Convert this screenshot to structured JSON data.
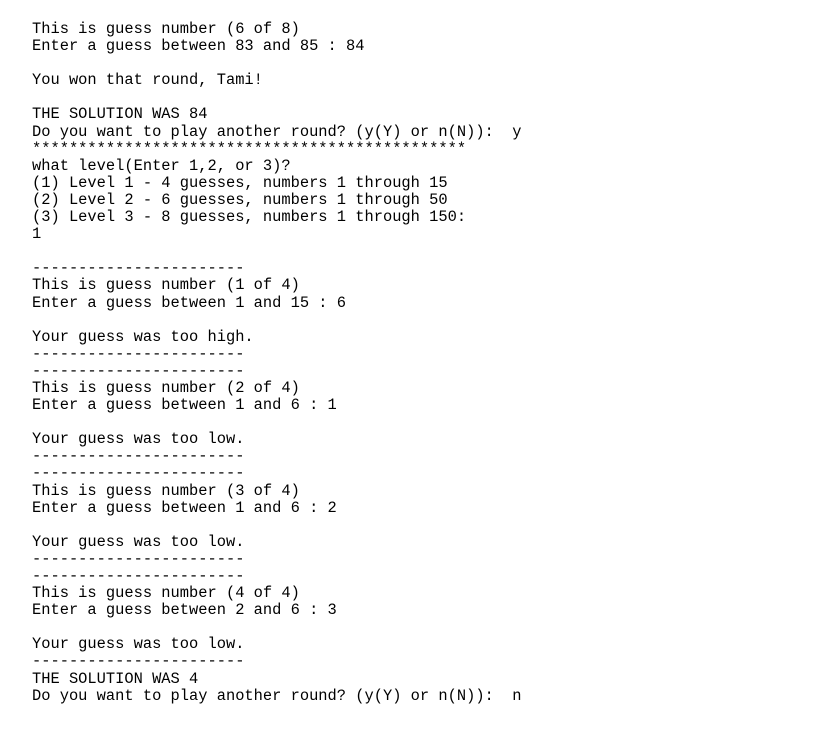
{
  "terminal": {
    "background_color": "#ffffff",
    "text_color": "#000000",
    "separator_dashes": "-----------------------",
    "separator_stars": "***********************************************",
    "lines": [
      "This is guess number (6 of 8)",
      "Enter a guess between 83 and 85 : 84",
      "",
      "You won that round, Tami!",
      "",
      "THE SOLUTION WAS 84",
      "Do you want to play another round? (y(Y) or n(N)):  y",
      "***********************************************",
      "what level(Enter 1,2, or 3)?",
      "(1) Level 1 - 4 guesses, numbers 1 through 15",
      "(2) Level 2 - 6 guesses, numbers 1 through 50",
      "(3) Level 3 - 8 guesses, numbers 1 through 150:",
      "1",
      "",
      "-----------------------",
      "This is guess number (1 of 4)",
      "Enter a guess between 1 and 15 : 6",
      "",
      "Your guess was too high.",
      "-----------------------",
      "-----------------------",
      "This is guess number (2 of 4)",
      "Enter a guess between 1 and 6 : 1",
      "",
      "Your guess was too low.",
      "-----------------------",
      "-----------------------",
      "This is guess number (3 of 4)",
      "Enter a guess between 1 and 6 : 2",
      "",
      "Your guess was too low.",
      "-----------------------",
      "-----------------------",
      "This is guess number (4 of 4)",
      "Enter a guess between 2 and 6 : 3",
      "",
      "Your guess was too low.",
      "-----------------------",
      "THE SOLUTION WAS 4",
      "Do you want to play another round? (y(Y) or n(N)):  n"
    ]
  },
  "session": {
    "player_name": "Tami",
    "round_one": {
      "guess_number_label": "This is guess number (6 of 8)",
      "prompt": "Enter a guess between 83 and 85 : 84",
      "range_low": 83,
      "range_high": 85,
      "guess_entered": 84,
      "result": "You won that round, Tami!",
      "solution_text": "THE SOLUTION WAS 84",
      "solution": 84,
      "guess_index": 6,
      "guess_total": 8,
      "play_again_prompt": "Do you want to play another round? (y(Y) or n(N)):  y",
      "play_again_answer": "y"
    },
    "level_menu": {
      "question": "what level(Enter 1,2, or 3)?",
      "options": [
        "(1) Level 1 - 4 guesses, numbers 1 through 15",
        "(2) Level 2 - 6 guesses, numbers 1 through 50",
        "(3) Level 3 - 8 guesses, numbers 1 through 150:"
      ],
      "selected": "1"
    },
    "round_two": {
      "guesses": [
        {
          "header": "This is guess number (1 of 4)",
          "prompt": "Enter a guess between 1 and 15 : 6",
          "feedback": "Your guess was too high.",
          "index": 1,
          "total": 4,
          "range_low": 1,
          "range_high": 15,
          "value": 6
        },
        {
          "header": "This is guess number (2 of 4)",
          "prompt": "Enter a guess between 1 and 6 : 1",
          "feedback": "Your guess was too low.",
          "index": 2,
          "total": 4,
          "range_low": 1,
          "range_high": 6,
          "value": 1
        },
        {
          "header": "This is guess number (3 of 4)",
          "prompt": "Enter a guess between 1 and 6 : 2",
          "feedback": "Your guess was too low.",
          "index": 3,
          "total": 4,
          "range_low": 1,
          "range_high": 6,
          "value": 2
        },
        {
          "header": "This is guess number (4 of 4)",
          "prompt": "Enter a guess between 2 and 6 : 3",
          "feedback": "Your guess was too low.",
          "index": 4,
          "total": 4,
          "range_low": 2,
          "range_high": 6,
          "value": 3
        }
      ],
      "solution_text": "THE SOLUTION WAS 4",
      "solution": 4,
      "play_again_prompt": "Do you want to play another round? (y(Y) or n(N)):  n",
      "play_again_answer": "n"
    }
  }
}
